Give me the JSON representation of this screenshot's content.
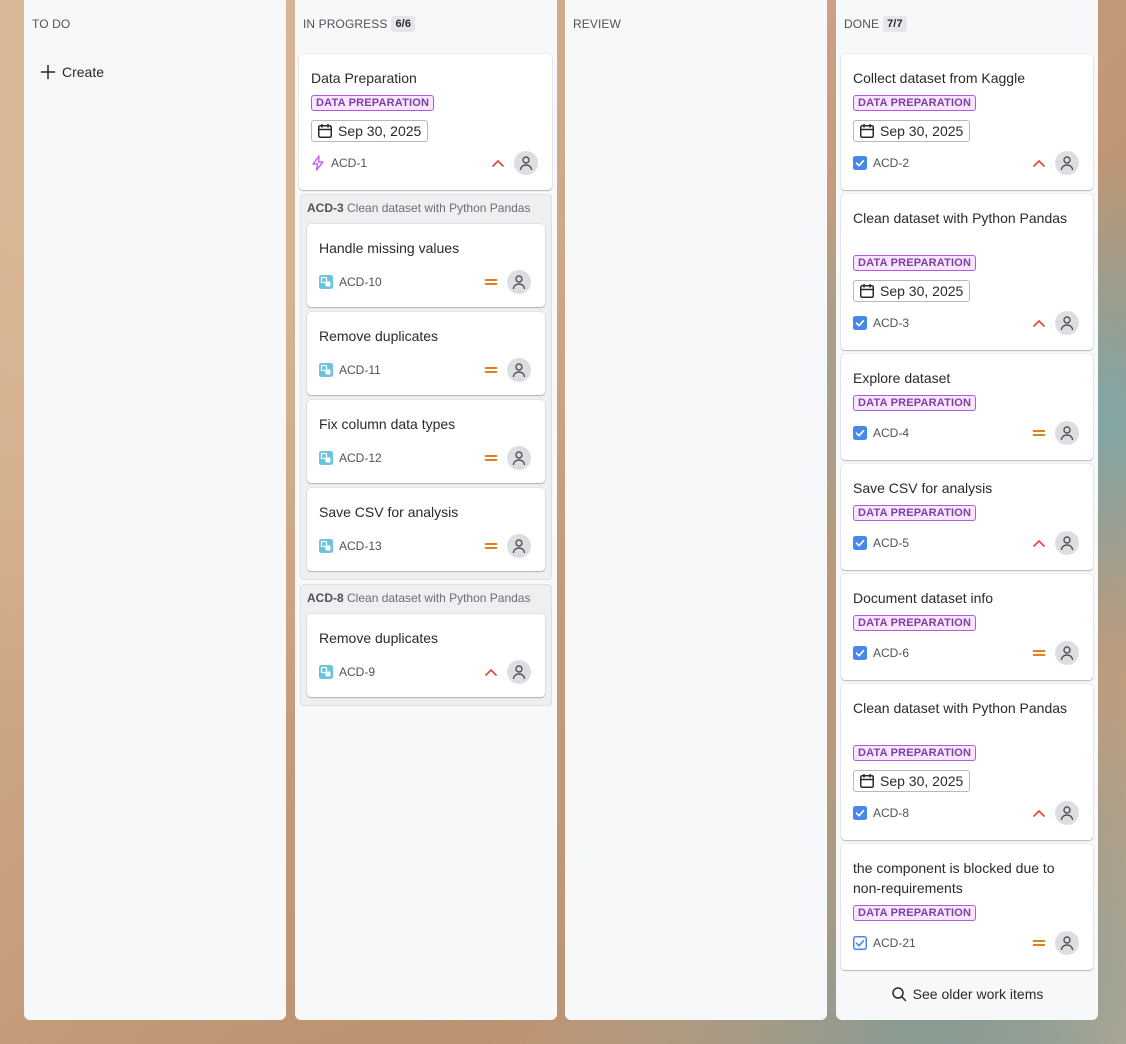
{
  "columns": {
    "todo": {
      "title": "TO DO",
      "create_label": "Create"
    },
    "progress": {
      "title": "IN PROGRESS",
      "count": "6/6"
    },
    "review": {
      "title": "REVIEW"
    },
    "done": {
      "title": "DONE",
      "count": "7/7",
      "see_older_label": "See older work items"
    }
  },
  "progress_cards": {
    "epic": {
      "title": "Data Preparation",
      "label": "DATA PREPARATION",
      "date": "Sep 30, 2025",
      "key": "ACD-1",
      "priority": "high"
    },
    "group1": {
      "parent_key": "ACD-3",
      "parent_title": "Clean dataset with Python Pandas",
      "items": [
        {
          "title": "Handle missing values",
          "key": "ACD-10",
          "priority": "medium"
        },
        {
          "title": "Remove duplicates",
          "key": "ACD-11",
          "priority": "medium"
        },
        {
          "title": "Fix column data types",
          "key": "ACD-12",
          "priority": "medium"
        },
        {
          "title": "Save CSV for analysis",
          "key": "ACD-13",
          "priority": "medium"
        }
      ]
    },
    "group2": {
      "parent_key": "ACD-8",
      "parent_title": "Clean dataset with Python Pandas",
      "items": [
        {
          "title": "Remove duplicates",
          "key": "ACD-9",
          "priority": "high"
        }
      ]
    }
  },
  "done_cards": [
    {
      "title": "Collect dataset from Kaggle",
      "label": "DATA PREPARATION",
      "date": "Sep 30, 2025",
      "key": "ACD-2",
      "priority": "high"
    },
    {
      "title": "Clean dataset with Python Pandas",
      "label": "DATA PREPARATION",
      "date": "Sep 30, 2025",
      "key": "ACD-3",
      "priority": "high"
    },
    {
      "title": "Explore dataset",
      "label": "DATA PREPARATION",
      "key": "ACD-4",
      "priority": "medium"
    },
    {
      "title": "Save CSV for analysis",
      "label": "DATA PREPARATION",
      "key": "ACD-5",
      "priority": "high"
    },
    {
      "title": "Document dataset info",
      "label": "DATA PREPARATION",
      "key": "ACD-6",
      "priority": "medium"
    },
    {
      "title": "Clean dataset with Python Pandas",
      "label": "DATA PREPARATION",
      "date": "Sep 30, 2025",
      "key": "ACD-8",
      "priority": "high"
    },
    {
      "title": "the component is blocked due to non-requirements",
      "label": "DATA PREPARATION",
      "key": "ACD-21",
      "priority": "medium"
    }
  ],
  "colors": {
    "priority_high": "#e2483d",
    "priority_medium": "#e06c00",
    "task_icon": "#4688ec",
    "subtask_icon": "#6cc3e0",
    "epic_icon": "#bf63f3",
    "label_bg": "#f8e6ff",
    "label_text": "#803fa5"
  },
  "icons": {
    "create": "plus-icon",
    "see_older": "search-icon",
    "date": "calendar-icon",
    "avatar": "user-icon",
    "epic": "lightning-icon",
    "task": "checkbox-icon",
    "subtask": "subtask-icon"
  }
}
